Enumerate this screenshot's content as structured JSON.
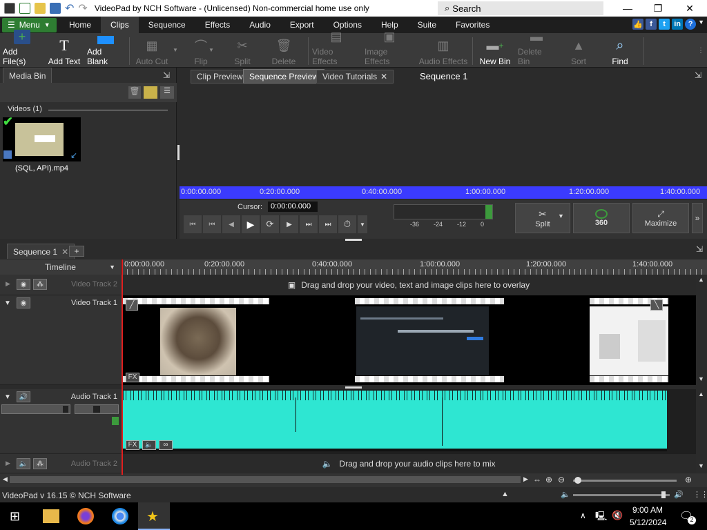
{
  "window": {
    "title": "VideoPad by NCH Software - (Unlicensed) Non-commercial home use only",
    "search_label": "Search"
  },
  "menu": {
    "menu_label": "Menu",
    "tabs": [
      "Home",
      "Clips",
      "Sequence",
      "Effects",
      "Audio",
      "Export",
      "Options",
      "Help",
      "Suite",
      "Favorites"
    ],
    "active_tab": "Clips"
  },
  "ribbon": {
    "add_files": "Add File(s)",
    "add_text": "Add Text",
    "add_blank": "Add Blank",
    "auto_cut": "Auto Cut",
    "flip": "Flip",
    "split": "Split",
    "delete": "Delete",
    "video_effects": "Video Effects",
    "image_effects": "Image Effects",
    "audio_effects": "Audio Effects",
    "new_bin": "New Bin",
    "delete_bin": "Delete Bin",
    "sort": "Sort",
    "find": "Find"
  },
  "media_bin": {
    "tab": "Media Bin",
    "group": "Videos (1)",
    "clip_name": "(SQL, API).mp4"
  },
  "preview": {
    "tabs": [
      "Clip Preview",
      "Sequence Preview",
      "Video Tutorials"
    ],
    "title": "Sequence 1",
    "ruler": [
      "0:00:00.000",
      "0:20:00.000",
      "0:40:00.000",
      "1:00:00.000",
      "1:20:00.000",
      "1:40:00.000"
    ],
    "cursor_label": "Cursor:",
    "cursor_value": "0:00:00.000",
    "meter": [
      "-36",
      "-24",
      "-12",
      "0"
    ],
    "split": "Split",
    "vr": "360",
    "maximize": "Maximize"
  },
  "timeline": {
    "seq_tab": "Sequence 1",
    "timeline_label": "Timeline",
    "ruler": [
      "0:00:00.000",
      "0:20:00.000",
      "0:40:00.000",
      "1:00:00.000",
      "1:20:00.000",
      "1:40:00.000"
    ],
    "video_track_2": "Video Track 2",
    "video_track_1": "Video Track 1",
    "audio_track_1": "Audio Track 1",
    "audio_track_2": "Audio Track 2",
    "overlay_hint": "Drag and drop your video, text and image clips here to overlay",
    "mix_hint": "Drag and drop your audio clips here to mix",
    "fx": "FX"
  },
  "status": {
    "version": "VideoPad v 16.15 © NCH Software"
  },
  "taskbar": {
    "time": "9:00 AM",
    "date": "5/12/2024",
    "notif": "2"
  },
  "colors": {
    "accent_green": "#2e7d32",
    "ruler_blue": "#3b3bff",
    "audio_wave": "#2ee6d2"
  }
}
